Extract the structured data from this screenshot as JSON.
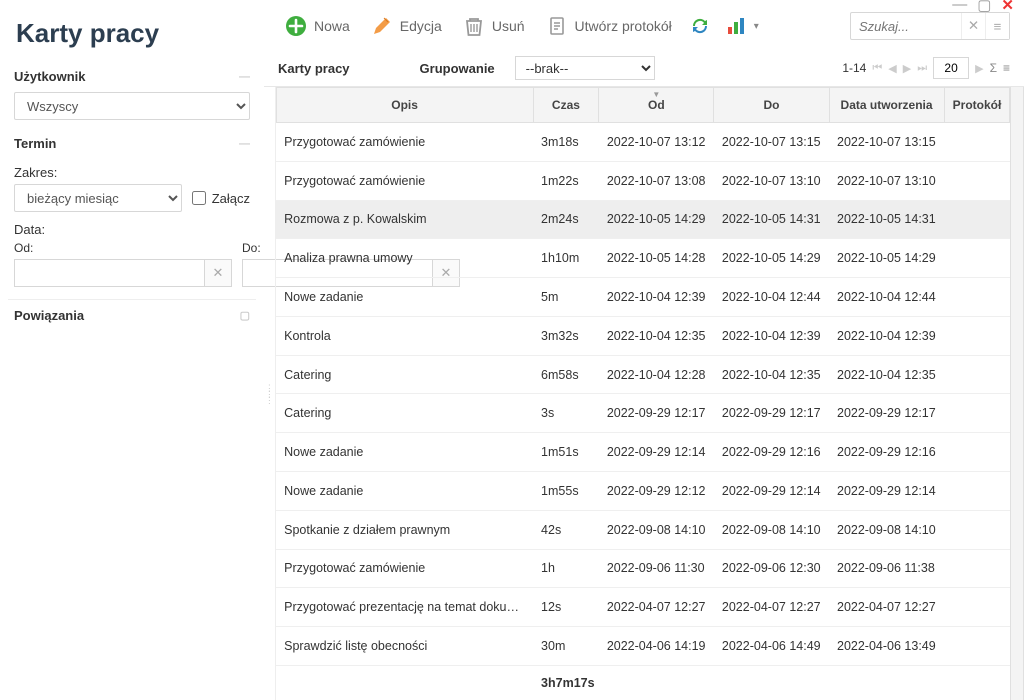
{
  "window_controls": {
    "minimize": "—",
    "maximize": "▢",
    "close": "✕"
  },
  "page_title": "Karty pracy",
  "sidebar": {
    "user_panel": {
      "title": "Użytkownik",
      "selected": "Wszyscy"
    },
    "term_panel": {
      "title": "Termin",
      "range_label": "Zakres:",
      "range_selected": "bieżący miesiąc",
      "attach_label": "Załącz",
      "date_label": "Data:",
      "from_label": "Od:",
      "to_label": "Do:"
    },
    "related_panel": {
      "title": "Powiązania"
    }
  },
  "toolbar": {
    "new_label": "Nowa",
    "edit_label": "Edycja",
    "delete_label": "Usuń",
    "protocol_label": "Utwórz protokół",
    "search_placeholder": "Szukaj..."
  },
  "grouping": {
    "section_title": "Karty pracy",
    "label": "Grupowanie",
    "selected": "--brak--",
    "pager_text": "1-14",
    "page_size": "20"
  },
  "table": {
    "headers": {
      "opis": "Opis",
      "czas": "Czas",
      "od": "Od",
      "do": "Do",
      "created": "Data utworzenia",
      "protokol": "Protokół"
    },
    "rows": [
      {
        "opis": "Przygotować zamówienie",
        "czas": "3m18s",
        "od": "2022-10-07 13:12",
        "do": "2022-10-07 13:15",
        "created": "2022-10-07 13:15",
        "prot": ""
      },
      {
        "opis": "Przygotować zamówienie",
        "czas": "1m22s",
        "od": "2022-10-07 13:08",
        "do": "2022-10-07 13:10",
        "created": "2022-10-07 13:10",
        "prot": ""
      },
      {
        "opis": "Rozmowa z p. Kowalskim",
        "czas": "2m24s",
        "od": "2022-10-05 14:29",
        "do": "2022-10-05 14:31",
        "created": "2022-10-05 14:31",
        "prot": "",
        "highlight": true
      },
      {
        "opis": "Analiza prawna umowy",
        "czas": "1h10m",
        "od": "2022-10-05 14:28",
        "do": "2022-10-05 14:29",
        "created": "2022-10-05 14:29",
        "prot": ""
      },
      {
        "opis": "Nowe zadanie",
        "czas": "5m",
        "od": "2022-10-04 12:39",
        "do": "2022-10-04 12:44",
        "created": "2022-10-04 12:44",
        "prot": ""
      },
      {
        "opis": "Kontrola",
        "czas": "3m32s",
        "od": "2022-10-04 12:35",
        "do": "2022-10-04 12:39",
        "created": "2022-10-04 12:39",
        "prot": ""
      },
      {
        "opis": "Catering",
        "czas": "6m58s",
        "od": "2022-10-04 12:28",
        "do": "2022-10-04 12:35",
        "created": "2022-10-04 12:35",
        "prot": ""
      },
      {
        "opis": "Catering",
        "czas": "3s",
        "od": "2022-09-29 12:17",
        "do": "2022-09-29 12:17",
        "created": "2022-09-29 12:17",
        "prot": ""
      },
      {
        "opis": "Nowe zadanie",
        "czas": "1m51s",
        "od": "2022-09-29 12:14",
        "do": "2022-09-29 12:16",
        "created": "2022-09-29 12:16",
        "prot": ""
      },
      {
        "opis": "Nowe zadanie",
        "czas": "1m55s",
        "od": "2022-09-29 12:12",
        "do": "2022-09-29 12:14",
        "created": "2022-09-29 12:14",
        "prot": ""
      },
      {
        "opis": "Spotkanie z działem prawnym",
        "czas": "42s",
        "od": "2022-09-08 14:10",
        "do": "2022-09-08 14:10",
        "created": "2022-09-08 14:10",
        "prot": ""
      },
      {
        "opis": "Przygotować zamówienie",
        "czas": "1h",
        "od": "2022-09-06 11:30",
        "do": "2022-09-06 12:30",
        "created": "2022-09-06 11:38",
        "prot": ""
      },
      {
        "opis": "Przygotować prezentację na temat dokumentów",
        "czas": "12s",
        "od": "2022-04-07 12:27",
        "do": "2022-04-07 12:27",
        "created": "2022-04-07 12:27",
        "prot": ""
      },
      {
        "opis": "Sprawdzić listę obecności",
        "czas": "30m",
        "od": "2022-04-06 14:19",
        "do": "2022-04-06 14:49",
        "created": "2022-04-06 13:49",
        "prot": ""
      }
    ],
    "footer_total": "3h7m17s"
  }
}
